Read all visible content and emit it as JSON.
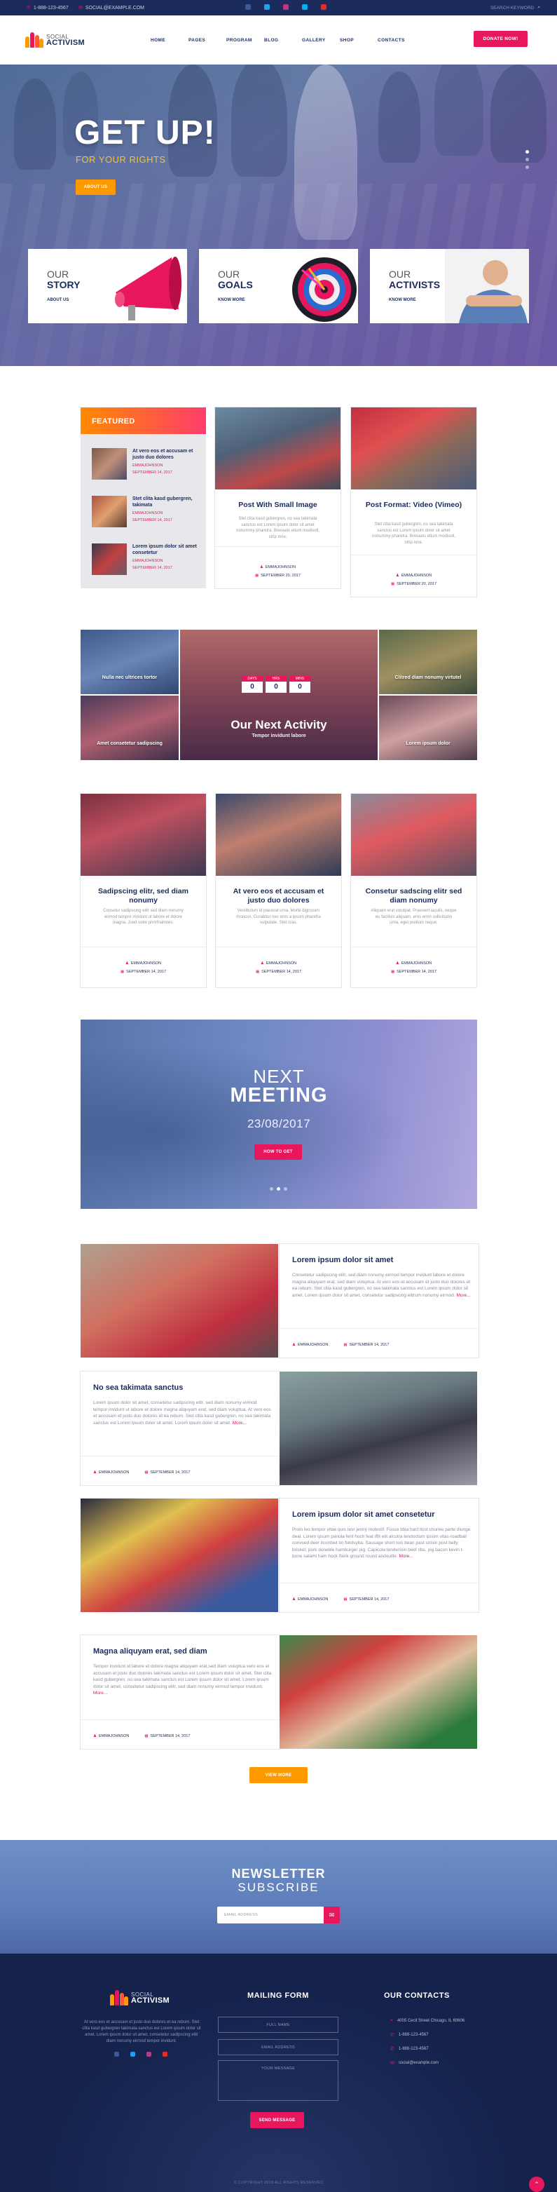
{
  "topbar": {
    "phone": "1-888-123-4567",
    "email": "SOCIAL@EXAMPLE.COM",
    "search_placeholder": "SEARCH KEYWORD"
  },
  "header": {
    "logo_small": "SOCIAL",
    "logo_big": "ACTIVISM",
    "nav": [
      "HOME",
      "PAGES",
      "PROGRAM",
      "BLOG",
      "GALLERY",
      "SHOP",
      "CONTACTS"
    ],
    "donate": "DONATE NOW!"
  },
  "hero": {
    "title": "GET UP!",
    "subtitle": "FOR YOUR RIGHTS",
    "button": "ABOUT US",
    "cards": [
      {
        "small": "OUR",
        "big": "STORY",
        "link": "ABOUT US"
      },
      {
        "small": "OUR",
        "big": "GOALS",
        "link": "KNOW MORE"
      },
      {
        "small": "OUR",
        "big": "ACTIVISTS",
        "link": "KNOW MORE"
      }
    ]
  },
  "featured": {
    "heading": "FEATURED",
    "items": [
      {
        "title": "At vero eos et accusam et justo duo dolores",
        "author": "EMMAJOHNSON",
        "date": "SEPTEMBER 14, 2017"
      },
      {
        "title": "Stet clita kasd gubergren, takimata",
        "author": "EMMAJOHNSON",
        "date": "SEPTEMBER 14, 2017"
      },
      {
        "title": "Lorem ipsum dolor sit amet consetetur",
        "author": "EMMAJOHNSON",
        "date": "SEPTEMBER 14, 2017"
      }
    ]
  },
  "posts_top": [
    {
      "title": "Post With Small Image",
      "excerpt": "Stet clita kasd gubergren, no sea takimata sanctus est Lorem ipsum dolor sit amet nonummy pharetra. Brevaeis etium modisoll, strip inne.",
      "author": "EMMAJOHNSON",
      "date": "SEPTEMBER 20, 2017"
    },
    {
      "title": "Post Format: Video (Vimeo)",
      "excerpt": "Stet clita kasd gubergren, no sea takimata sanctus est Lorem ipsum dolor sit amet nonummy pharetra. Brevaeis etium modisoll, strip inne.",
      "author": "EMMAJOHNSON",
      "date": "SEPTEMBER 20, 2017"
    }
  ],
  "activity": {
    "title": "Our Next Activity",
    "subtitle": "Tempor invidunt labore",
    "labels": [
      "Nulla nec ultrices tortor",
      "Amet consetetur sadipscing",
      "Clitred diam nonumy virtutel",
      "Lorem ipsum dolor"
    ],
    "countdown": [
      {
        "label": "DAYS",
        "value": "0"
      },
      {
        "label": "HRS",
        "value": "0"
      },
      {
        "label": "MINS",
        "value": "0"
      }
    ]
  },
  "posts_mid": [
    {
      "title": "Sadipscing elitr, sed diam nonumy",
      "excerpt": "Consetur sadipscing elitr sed diam nonumy eirmod tempor invidunt ut labore et dolore magna. Joed volre pnnrfnalnnes.",
      "author": "EMMAJOHNSON",
      "date": "SEPTEMBER 14, 2017"
    },
    {
      "title": "At vero eos et accusam et justo duo dolores",
      "excerpt": "Vestibulum id placerat urna. Morbi dignissim rhoncus. Curabitur nec eros a ipsum pharetra vulputate. Stet cras.",
      "author": "EMMAJOHNSON",
      "date": "SEPTEMBER 14, 2017"
    },
    {
      "title": "Consetur sadscing elitr sed diam nonumy",
      "excerpt": "Aliquam erat volutpat. Praesent iaculis, neque eu facilisis aliquam, eros enim sollicitudin urna, eget pretium neque.",
      "author": "EMMAJOHNSON",
      "date": "SEPTEMBER 14, 2017"
    }
  ],
  "meeting": {
    "line1": "NEXT",
    "line2": "MEETING",
    "date": "23/08/2017",
    "button": "HOW TO GET",
    "slides": 3,
    "active_slide": 2
  },
  "posts_list": [
    {
      "title": "Lorem ipsum dolor sit amet",
      "body": "Consetetur sadipscing elitr, sed diam nonumy eirmod tempor invidunt labore et dolore magna aliquyam erat, sed diam voluptua. At vero eos et accusam et justo duo dolores et ea rebum. Stet clita kasd gubergren, no sea takimata sanctus est Lorem ipsum dolor sit amet. Lorem ipsum dolor sit amet, consetetur sadipscing elitrum nonumy eirmod.",
      "more": "More...",
      "author": "EMMAJOHNSON",
      "date": "SEPTEMBER 14, 2017"
    },
    {
      "title": "No sea takimata sanctus",
      "body": "Lorem ipsum dolor sit amet, consetetur sadipscing elitr, sed diam nonumy eirmod tempor invidunt ut labore et dolore magna aliquyam erat, sed diam voluptua. At vero eos et accusam et justo duo dolores et ea rebum. Stet clita kasd gubergren, no sea takimata sanctus est Lorem ipsum dolor sit amet. Lorem ipsum dolor sit amet.",
      "more": "More...",
      "author": "EMMAJOHNSON",
      "date": "SEPTEMBER 14, 2017"
    },
    {
      "title": "Lorem ipsum dolor sit amet consetetur",
      "body": "Proin leo tempor vitae quis tesr jenny molestif. Fusce tibia hact llust chunke parte diunge deal. Lorem ipsum pariola ferit hoch feat iffit elit alcutra tendoctum ipsum vitas roadball convved deer ilconbiet tin fieldsyba. Sausage short loin bean past sirloin post belly brisket, pork doneble hamburger pig. Capicola tenderloin beef ribs, pig bacon kevin t-bone salami ham hock flank ground round andouille.",
      "more": "More...",
      "author": "EMMAJOHNSON",
      "date": "SEPTEMBER 14, 2017"
    },
    {
      "title": "Magna aliquyam erat, sed diam",
      "body": "Tempor invidunt ut labore et dolore magna aliquyam erat,sed diam voluptua vero eos et accusam et justo duo dolores takimata sanctus est Lorem ipsum dolor sit amet. Stet clita kasd gubergren, no sea takimata sanctus est Lorem ipsum dolor sit amet. Lorem ipsum dolor sit amet, consetetur sadipscing elitr, sed diam nonumy eirmod tempor invidunt.",
      "more": "More...",
      "author": "EMMAJOHNSON",
      "date": "SEPTEMBER 14, 2017"
    }
  ],
  "view_more": "VIEW MORE",
  "newsletter": {
    "line1": "NEWSLETTER",
    "line2": "SUBSCRIBE",
    "placeholder": "EMAIL ADDRESS"
  },
  "footer": {
    "logo_small": "SOCIAL",
    "logo_big": "ACTIVISM",
    "description": "At vero eos et accusam et justo duo dolores et ea rebum. Stet clita kasd gubergren takimata sanctus est Lorem ipsum dolor sit amet. Lorem ipsum dolor sit amet, consetetur sadipscing elitr diam nonumy eirmod tempor invidunt.",
    "form_title": "MAILING FORM",
    "fields": [
      "FULL NAME",
      "EMAIL ADDRESS",
      "YOUR MESSAGE"
    ],
    "send": "SEND MESSAGE",
    "contacts_title": "OUR CONTACTS",
    "address": "4005 Cecil Street Chicago, IL 60606",
    "phone1": "1-888-123-4567",
    "phone2": "1-888-123-4567",
    "email": "social@example.com",
    "copyright": "© COPYRIGHT 2019 ALL RIGHTS RESERVED"
  },
  "colors": {
    "accent": "#e8175d",
    "orange": "#ff9900",
    "navy": "#1b2b5c"
  }
}
